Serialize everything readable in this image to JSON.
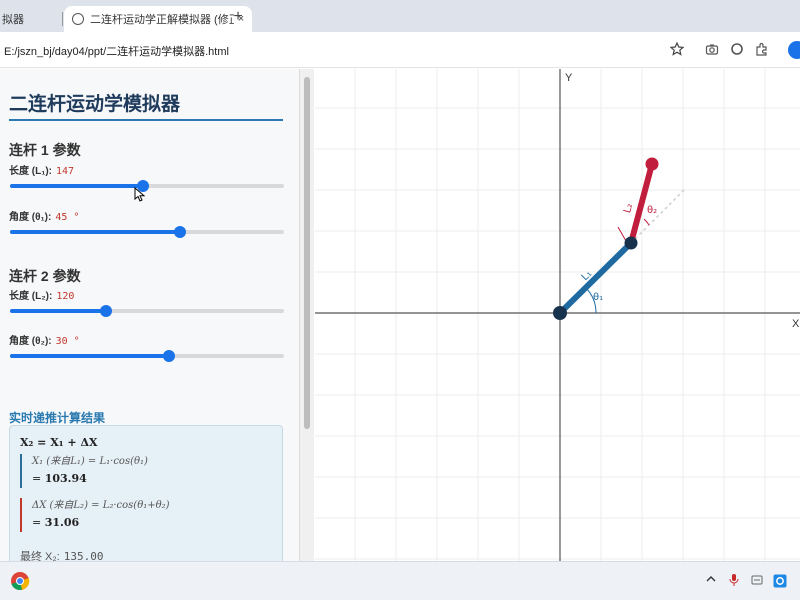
{
  "browser": {
    "tabs": [
      {
        "title": "拟器"
      },
      {
        "title": "二连杆运动学正解模拟器 (修正"
      }
    ],
    "new_tab": "+",
    "close": "×",
    "url": "E:/jszn_bj/day04/ppt/二连杆运动学模拟器.html"
  },
  "sidebar": {
    "title": "二连杆运动学模拟器",
    "link1": {
      "heading": "连杆 1 参数",
      "length_label": "长度 (L₁):",
      "length_value": "147",
      "angle_label": "角度 (θ₁):",
      "angle_value": "45 °"
    },
    "link2": {
      "heading": "连杆 2 参数",
      "length_label": "长度 (L₂):",
      "length_value": "120",
      "angle_label": "角度 (θ₂):",
      "angle_value": "30 °"
    },
    "sliders": {
      "l1_length_fraction": 0.485,
      "l1_angle_fraction": 0.62,
      "l2_length_fraction": 0.35,
      "l2_angle_fraction": 0.58
    },
    "results": {
      "heading": "实时递推计算结果",
      "formula": "X₂ = X₁ + ΔX",
      "x1_line": "X₁ (来自L₁) = L₁·cos(θ₁)",
      "x1_value_eq": "=",
      "x1_value": "103.94",
      "dx_line": "ΔX (来自L₂) = L₂·cos(θ₁+θ₂)",
      "dx_value_eq": "=",
      "dx_value": "31.06",
      "final_label": "最终 X₂:",
      "final_value": "135.00"
    }
  },
  "canvas": {
    "x_axis_label": "X",
    "y_axis_label": "Y",
    "link1_label": "L₁",
    "link2_label": "L₂",
    "theta1_label": "θ₁",
    "theta2_label": "θ₂",
    "colors": {
      "link1": "#1f6aa0",
      "link2": "#c01e3c",
      "joint": "#17324d",
      "grid": "#ececec",
      "axis": "#555555",
      "theta1": "#1f6aa0",
      "theta2": "#c01e3c"
    }
  },
  "icons": [
    "globe-icon",
    "star-icon",
    "camera-icon",
    "circle-icon",
    "extensions-icon",
    "profile-icon",
    "chrome-icon",
    "chevron-up-icon",
    "mic-icon",
    "ime-icon",
    "tray-app-icon"
  ]
}
